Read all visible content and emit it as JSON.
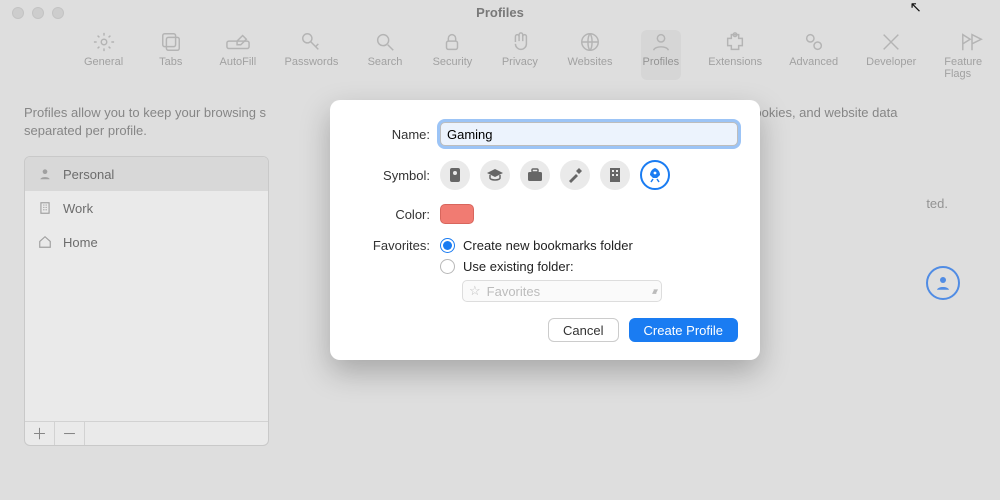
{
  "window_title": "Profiles",
  "toolbar": [
    {
      "id": "general",
      "label": "General"
    },
    {
      "id": "tabs",
      "label": "Tabs"
    },
    {
      "id": "autofill",
      "label": "AutoFill"
    },
    {
      "id": "passwords",
      "label": "Passwords"
    },
    {
      "id": "search",
      "label": "Search"
    },
    {
      "id": "security",
      "label": "Security"
    },
    {
      "id": "privacy",
      "label": "Privacy"
    },
    {
      "id": "websites",
      "label": "Websites"
    },
    {
      "id": "profiles",
      "label": "Profiles",
      "active": true
    },
    {
      "id": "extensions",
      "label": "Extensions"
    },
    {
      "id": "advanced",
      "label": "Advanced"
    },
    {
      "id": "developer",
      "label": "Developer"
    },
    {
      "id": "featureflags",
      "label": "Feature Flags"
    }
  ],
  "info_line1": "Profiles allow you to keep your browsing s",
  "info_line2": "separated per profile.",
  "info_line1_right": " history, cookies, and website data",
  "sidebar": {
    "items": [
      {
        "label": "Personal",
        "icon": "person-icon",
        "selected": true
      },
      {
        "label": "Work",
        "icon": "building-icon"
      },
      {
        "label": "Home",
        "icon": "house-icon"
      }
    ],
    "add_glyph": "＋",
    "remove_glyph": "－"
  },
  "rightpane": {
    "visible_text": "ted."
  },
  "modal": {
    "labels": {
      "name": "Name:",
      "symbol": "Symbol:",
      "color": "Color:",
      "favorites": "Favorites:"
    },
    "name_value": "Gaming",
    "symbols": [
      {
        "id": "id-badge",
        "name": "badge-icon"
      },
      {
        "id": "grad",
        "name": "graduation-cap-icon"
      },
      {
        "id": "briefcase",
        "name": "briefcase-icon"
      },
      {
        "id": "hammer",
        "name": "hammer-icon"
      },
      {
        "id": "building",
        "name": "building-icon"
      },
      {
        "id": "rocket",
        "name": "rocket-icon",
        "selected": true
      }
    ],
    "color_hex": "#f17b72",
    "favorites": {
      "option_create": "Create new bookmarks folder",
      "option_existing": "Use existing folder:",
      "selected": "create",
      "folder_placeholder": "Favorites"
    },
    "buttons": {
      "cancel": "Cancel",
      "create": "Create Profile"
    }
  }
}
